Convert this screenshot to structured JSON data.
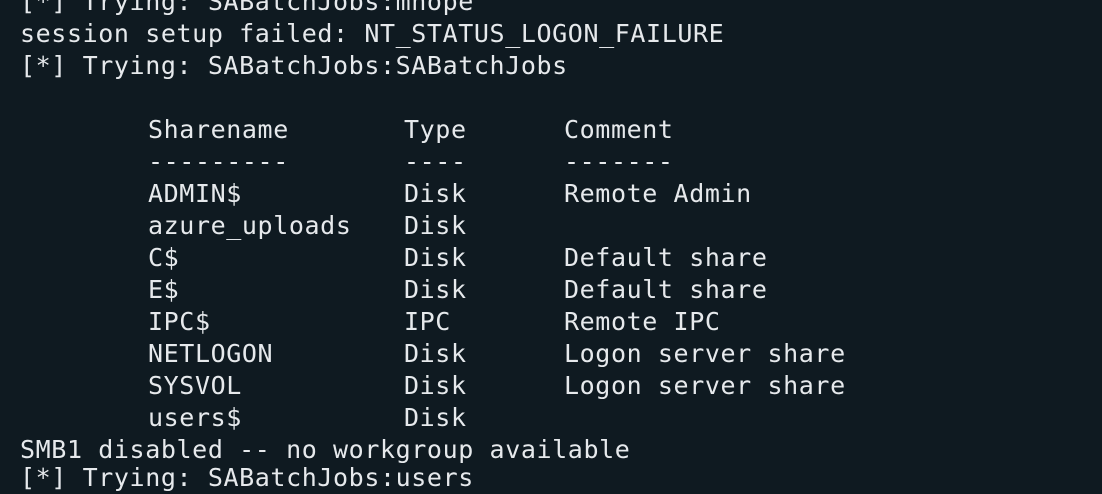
{
  "terminal": {
    "lines_before": [
      "[*] Trying: SABatchJobs:mnope",
      "session setup failed: NT_STATUS_LOGON_FAILURE",
      "[*] Trying: SABatchJobs:SABatchJobs"
    ],
    "table": {
      "headers": [
        "Sharename",
        "Type",
        "Comment"
      ],
      "separators": [
        "---------",
        "----",
        "-------"
      ],
      "rows": [
        [
          "ADMIN$",
          "Disk",
          "Remote Admin"
        ],
        [
          "azure_uploads",
          "Disk",
          ""
        ],
        [
          "C$",
          "Disk",
          "Default share"
        ],
        [
          "E$",
          "Disk",
          "Default share"
        ],
        [
          "IPC$",
          "IPC",
          "Remote IPC"
        ],
        [
          "NETLOGON",
          "Disk",
          "Logon server share"
        ],
        [
          "SYSVOL",
          "Disk",
          "Logon server share"
        ],
        [
          "users$",
          "Disk",
          ""
        ]
      ]
    },
    "lines_after": [
      "SMB1 disabled -- no workgroup available",
      "[*] Trying: SABatchJobs:users"
    ]
  },
  "colors": {
    "background": "#0f1a21",
    "foreground": "#e6e9ec"
  }
}
